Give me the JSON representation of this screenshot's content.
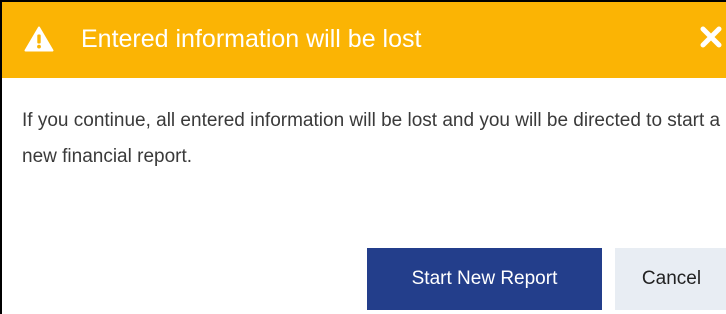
{
  "dialog": {
    "header": {
      "icon": "warning-triangle-icon",
      "title": "Entered information will be lost",
      "close_icon": "close-icon",
      "color": "#fbb404"
    },
    "body": {
      "message": "If you continue, all entered information will be lost and you will be directed to start a new financial report."
    },
    "footer": {
      "primary_label": "Start New Report",
      "primary_color": "#233e8b",
      "secondary_label": "Cancel",
      "secondary_color": "#e8edf3"
    }
  }
}
